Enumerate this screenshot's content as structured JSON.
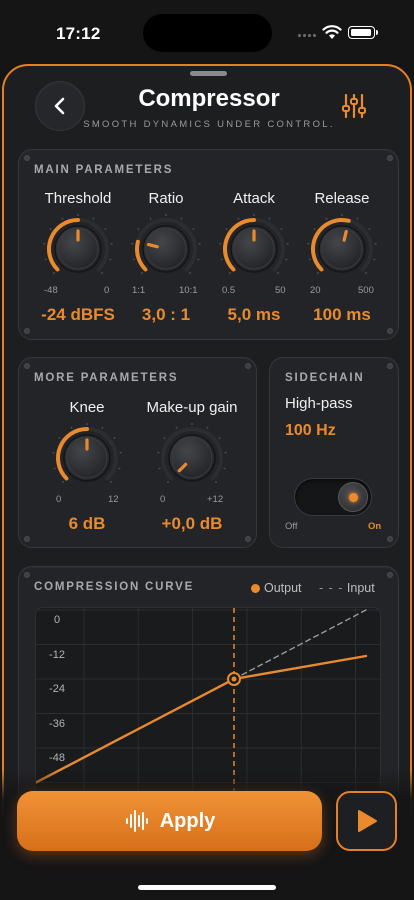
{
  "status_bar": {
    "time": "17:12"
  },
  "header": {
    "title": "Compressor",
    "subtitle": "SMOOTH DYNAMICS UNDER CONTROL."
  },
  "colors": {
    "accent": "#e88a2d",
    "panel": "#232427",
    "background": "#151516"
  },
  "main_parameters": {
    "title": "MAIN PARAMETERS",
    "knobs": [
      {
        "label": "Threshold",
        "min": "-48",
        "max": "0",
        "value": "-24 dBFS",
        "level": 0.5
      },
      {
        "label": "Ratio",
        "min": "1:1",
        "max": "10:1",
        "value": "3,0 : 1",
        "level": 0.22
      },
      {
        "label": "Attack",
        "min": "0.5",
        "max": "50",
        "value": "5,0 ms",
        "level": 0.5
      },
      {
        "label": "Release",
        "min": "20",
        "max": "500",
        "value": "100 ms",
        "level": 0.55
      }
    ]
  },
  "more_parameters": {
    "title": "MORE PARAMETERS",
    "knobs": [
      {
        "label": "Knee",
        "min": "0",
        "max": "12",
        "value": "6 dB",
        "level": 0.5
      },
      {
        "label": "Make-up gain",
        "min": "0",
        "max": "+12",
        "value": "+0,0 dB",
        "level": 0.0
      }
    ]
  },
  "sidechain": {
    "title": "SIDECHAIN",
    "label": "High-pass",
    "value": "100 Hz",
    "toggle_off": "Off",
    "toggle_on": "On",
    "enabled": true
  },
  "compression_curve": {
    "title": "COMPRESSION CURVE",
    "legend_output": "Output",
    "legend_input": "Input",
    "y_ticks": [
      "0",
      "-12",
      "-24",
      "-36",
      "-48"
    ]
  },
  "chart_data": {
    "type": "line",
    "title": "COMPRESSION CURVE",
    "y_ticks": [
      0,
      -12,
      -24,
      -36,
      -48
    ],
    "ylim": [
      -60,
      0
    ],
    "xlim": [
      -60,
      0
    ],
    "threshold": -24,
    "series": [
      {
        "name": "Output",
        "x": [
          -60,
          -24,
          0
        ],
        "y": [
          -60,
          -24,
          -16
        ]
      },
      {
        "name": "Input",
        "x": [
          -24,
          0
        ],
        "y": [
          -24,
          0
        ]
      }
    ]
  },
  "bottom": {
    "apply_label": "Apply"
  }
}
